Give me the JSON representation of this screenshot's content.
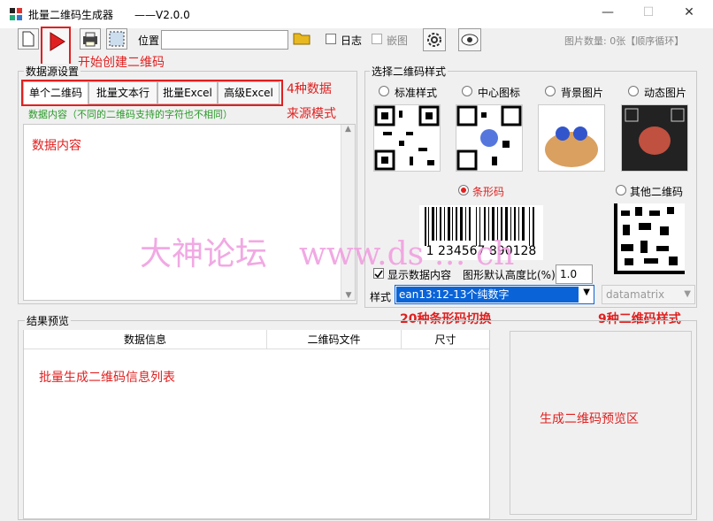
{
  "window": {
    "title": "批量二维码生成器　　——V2.0.0",
    "minimize": "—",
    "maximize": "☐",
    "close": "✕"
  },
  "toolbar": {
    "location_label": "位置",
    "location_value": "",
    "log_label": "日志",
    "embed_label": "嵌图",
    "image_count_label": "图片数量: 0张【顺序循环】"
  },
  "annotations": {
    "start": "开始创建二维码",
    "four_sources": "4种数据",
    "source_mode": "来源模式",
    "data_content": "数据内容",
    "barcode_switch": "20种条形码切换",
    "qr_styles": "9种二维码样式",
    "batch_list": "批量生成二维码信息列表",
    "preview_area": "生成二维码预览区"
  },
  "data_source": {
    "group_label": "数据源设置",
    "tabs": [
      "单个二维码",
      "批量文本行",
      "批量Excel",
      "高级Excel"
    ],
    "hint": "数据内容（不同的二维码支持的字符也不相同）"
  },
  "style_panel": {
    "group_label": "选择二维码样式",
    "options": [
      "标准样式",
      "中心图标",
      "背景图片",
      "动态图片"
    ],
    "barcode_label": "条形码",
    "other_label": "其他二维码",
    "barcode_number": "1 234567 890128",
    "show_data_label": "显示数据内容",
    "height_ratio_label": "图形默认高度比(%)",
    "height_ratio_value": "1.0",
    "style_label": "样式",
    "style_value": "ean13:12-13个纯数字",
    "other_style_value": "datamatrix"
  },
  "results": {
    "group_label": "结果预览",
    "columns": [
      "数据信息",
      "二维码文件",
      "尺寸"
    ]
  },
  "watermark": "大神论坛　www.ds  … ch",
  "colors": {
    "annotation_red": "#e02020",
    "hint_green": "#2a9a2a",
    "select_blue": "#0a64d8"
  }
}
